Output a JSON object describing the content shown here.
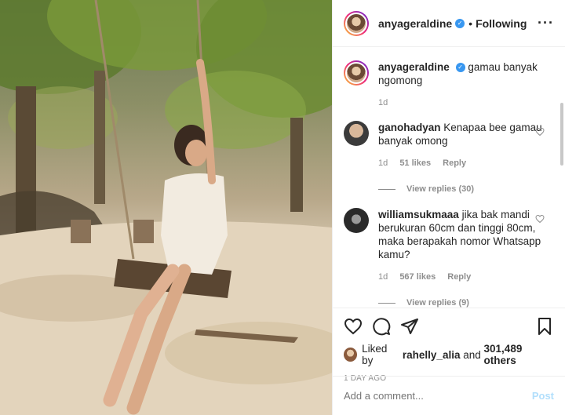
{
  "post": {
    "username": "anyageraldine",
    "follow_status": "Following",
    "separator": "•",
    "more_icon": "more-options-icon"
  },
  "caption": {
    "username": "anyageraldine",
    "text": "gamau banyak ngomong",
    "time": "1d"
  },
  "comments": [
    {
      "username": "ganohadyan",
      "text": "Kenapaa bee gamau banyak omong",
      "time": "1d",
      "likes": "51 likes",
      "reply_label": "Reply",
      "view_replies": "View replies (30)"
    },
    {
      "username": "williamsukmaaa",
      "text": "jika bak mandi berukuran 60cm dan tinggi 80cm, maka berapakah nomor Whatsapp kamu?",
      "time": "1d",
      "likes": "567 likes",
      "reply_label": "Reply",
      "view_replies": "View replies (9)"
    }
  ],
  "engagement": {
    "liked_by_prefix": "Liked by",
    "liked_by_user": "rahelly_alia",
    "and_label": "and",
    "others": "301,489 others",
    "date": "1 DAY AGO"
  },
  "composer": {
    "placeholder": "Add a comment...",
    "post_label": "Post"
  },
  "colors": {
    "verified": "#3897f0",
    "post_button_disabled": "#b2dffc",
    "secondary_text": "#8e8e8e"
  }
}
